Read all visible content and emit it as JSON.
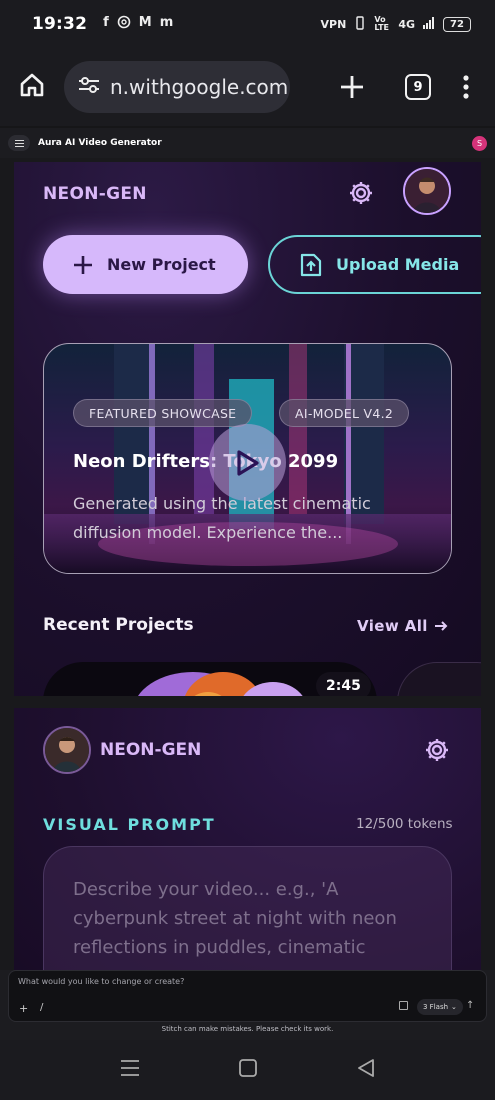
{
  "status_bar": {
    "time": "19:32",
    "notification_icons": [
      "facebook-icon",
      "openai-icon",
      "gmail-icon",
      "m-app-icon"
    ],
    "network_label": "4G",
    "volte_label": "Vo LTE",
    "vpn_label": "VPN",
    "battery": "72"
  },
  "browser": {
    "url": "n.withgoogle.com",
    "tab_count": "9"
  },
  "app": {
    "title": "Aura AI Video Generator",
    "user_initial": "S"
  },
  "screen1": {
    "brand": "NEON-GEN",
    "new_project_label": "New Project",
    "upload_media_label": "Upload Media",
    "showcase": {
      "chip_featured": "FEATURED SHOWCASE",
      "chip_model": "AI-MODEL V4.2",
      "title": "Neon Drifters: Tokyo 2099",
      "description": "Generated using the latest cinematic diffusion model. Experience the..."
    },
    "recent_projects_label": "Recent Projects",
    "view_all_label": "View All",
    "thumb_duration": "2:45"
  },
  "screen2": {
    "brand": "NEON-GEN",
    "visual_prompt_label": "VISUAL PROMPT",
    "tokens": "12/500 tokens",
    "prompt_placeholder": "Describe your video... e.g., 'A cyberpunk street at night with neon reflections in puddles, cinematic"
  },
  "chat": {
    "placeholder": "What would you like to change or create?",
    "plus_label": "+",
    "slash_label": "/",
    "model_label": "3 Flash",
    "disclaimer": "Stitch can make mistakes. Please check its work."
  },
  "colors": {
    "accent_purple": "#d6b8fb",
    "accent_cyan": "#6bd4d6",
    "brand_text": "#d9b8f7"
  }
}
